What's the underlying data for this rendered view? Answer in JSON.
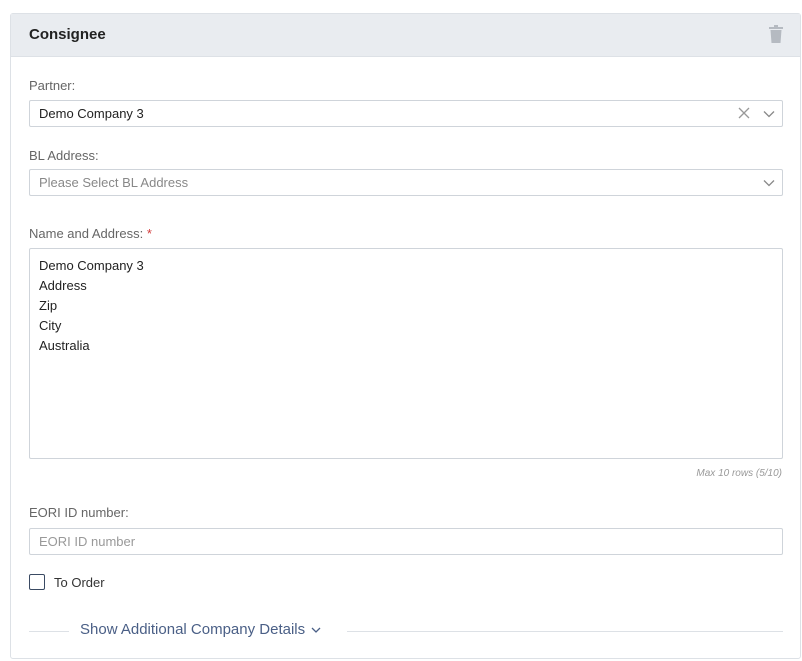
{
  "panel": {
    "title": "Consignee"
  },
  "partner": {
    "label": "Partner:",
    "value": "Demo Company 3"
  },
  "bl_address": {
    "label": "BL Address:",
    "placeholder": "Please Select BL Address"
  },
  "name_address": {
    "label": "Name and Address:",
    "required_mark": "*",
    "lines": [
      "Demo Company 3",
      "Address",
      "Zip",
      "City",
      "Australia"
    ],
    "hint": "Max 10 rows (5/10)"
  },
  "eori": {
    "label": "EORI ID number:",
    "placeholder": "EORI ID number"
  },
  "to_order": {
    "label": "To Order",
    "checked": false
  },
  "show_more": {
    "label": "Show Additional Company Details"
  }
}
